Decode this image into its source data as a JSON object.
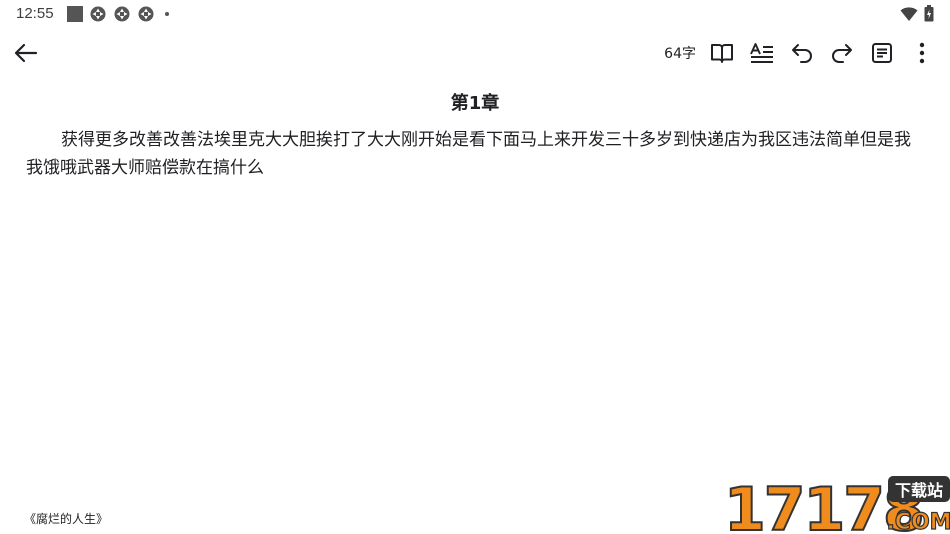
{
  "status": {
    "time": "12:55",
    "icons": [
      "square-icon",
      "sync-icon",
      "sync-icon",
      "sync-icon",
      "dot-icon",
      "wifi-icon",
      "battery-icon"
    ]
  },
  "toolbar": {
    "word_count": "64字",
    "icons": [
      "back-arrow-icon",
      "book-icon",
      "text-format-icon",
      "undo-icon",
      "redo-icon",
      "notes-icon",
      "more-vert-icon"
    ]
  },
  "chapter": {
    "title": "第1章",
    "body": "获得更多改善改善法埃里克大大胆挨打了大大刚开始是看下面马上来开发三十多岁到快递店为我区违法简单但是我我饿哦武器大师赔偿款在搞什么"
  },
  "footer": {
    "book_name": "《腐烂的人生》"
  },
  "watermark": {
    "brand": "17178",
    "tag": "下载站",
    "domain": ".COM"
  },
  "colors": {
    "text": "#202124",
    "watermark_orange": "#f08c1e",
    "watermark_dark": "#333333"
  }
}
